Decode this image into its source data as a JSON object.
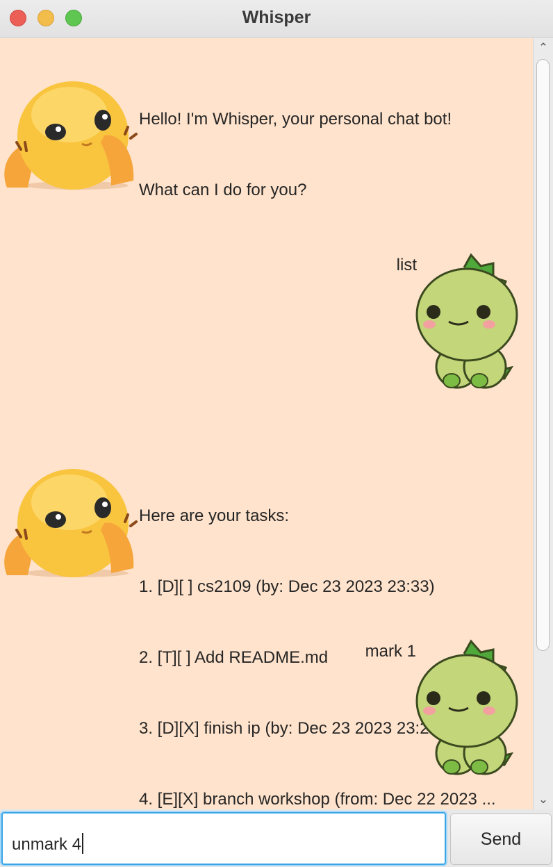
{
  "window": {
    "title": "Whisper"
  },
  "messages": {
    "m1": {
      "sender": "bot",
      "lines": [
        "Hello! I'm Whisper, your personal chat bot!",
        "What can I do for you?"
      ]
    },
    "m2": {
      "sender": "user",
      "text": "list"
    },
    "m3": {
      "sender": "bot",
      "lines": [
        "Here are your tasks:",
        "1. [D][ ] cs2109 (by: Dec 23 2023 23:33)",
        "2. [T][ ] Add README.md",
        "3. [D][X] finish ip (by: Dec 23 2023 23:22)",
        "4. [E][X] branch workshop (from: Dec 22 2023 ..."
      ]
    },
    "m4": {
      "sender": "user",
      "text": "mark 1"
    }
  },
  "avatars": {
    "bot": "yellow-creature-avatar",
    "user": "green-dinosaur-avatar"
  },
  "input": {
    "value": "unmark 4"
  },
  "send_label": "Send",
  "colors": {
    "chat_background": "#ffe3cc",
    "input_focus": "#39a6e8"
  }
}
